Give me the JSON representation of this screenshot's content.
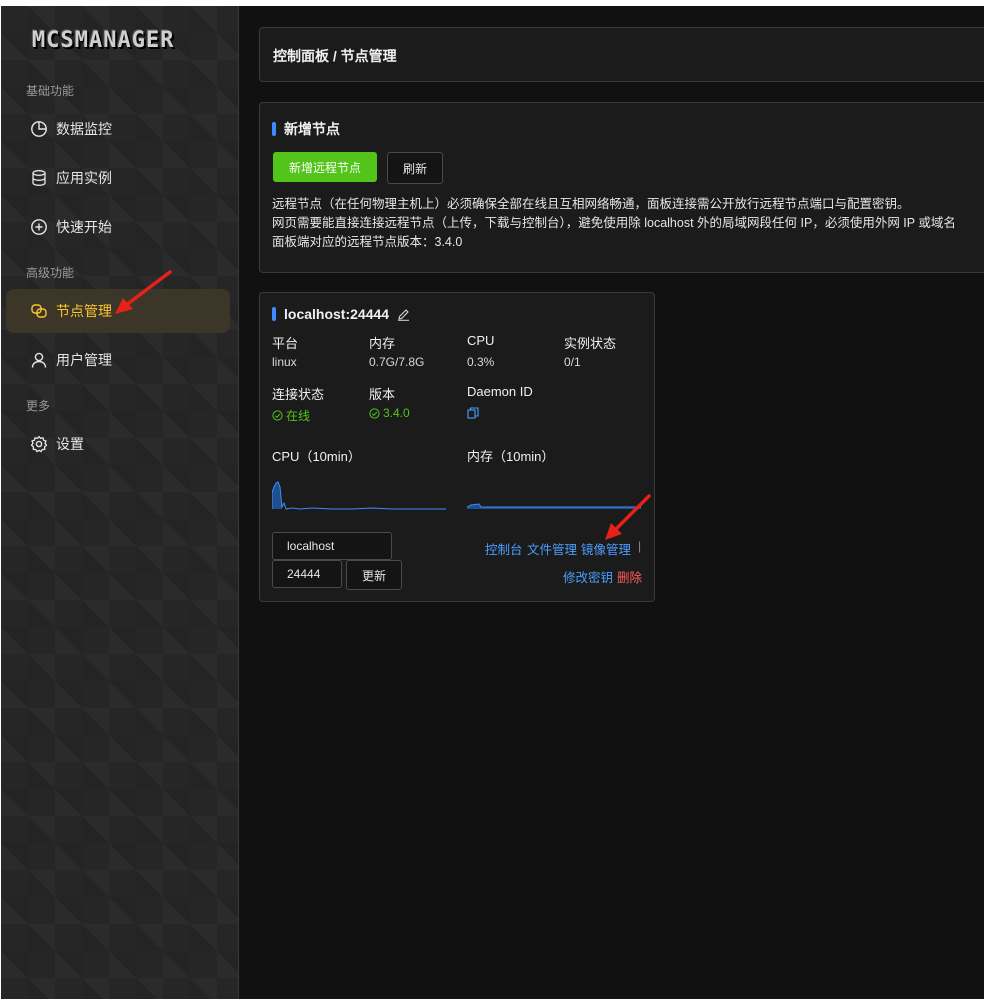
{
  "sidebar": {
    "logo": "MCSMANAGER",
    "sections": [
      "基础功能",
      "高级功能",
      "更多"
    ],
    "items": [
      {
        "label": "数据监控",
        "icon": "pie-chart-icon"
      },
      {
        "label": "应用实例",
        "icon": "database-icon"
      },
      {
        "label": "快速开始",
        "icon": "plus-circle-icon"
      },
      {
        "label": "节点管理",
        "icon": "nodes-icon",
        "active": true
      },
      {
        "label": "用户管理",
        "icon": "user-icon"
      },
      {
        "label": "设置",
        "icon": "gear-icon"
      }
    ]
  },
  "breadcrumb": "控制面板 / 节点管理",
  "add_node": {
    "title": "新增节点",
    "add_button": "新增远程节点",
    "refresh_button": "刷新",
    "desc1": "远程节点（在任何物理主机上）必须确保全部在线且互相网络畅通，面板连接需公开放行远程节点端口与配置密钥。",
    "desc2": "网页需要能直接连接远程节点（上传，下载与控制台），避免使用除 localhost 外的局域网段任何 IP，必须使用外网 IP 或域名",
    "desc3": "面板端对应的远程节点版本：3.4.0"
  },
  "node": {
    "title": "localhost:24444",
    "platform_label": "平台",
    "platform_value": "linux",
    "memory_label": "内存",
    "memory_value": "0.7G/7.8G",
    "cpu_label": "CPU",
    "cpu_value": "0.3%",
    "instance_label": "实例状态",
    "instance_value": "0/1",
    "conn_label": "连接状态",
    "conn_value": "在线",
    "version_label": "版本",
    "version_value": "3.4.0",
    "daemon_label": "Daemon ID",
    "cpu_chart_label": "CPU（10min）",
    "mem_chart_label": "内存（10min）",
    "host_value": "localhost",
    "port_value": "24444",
    "update_button": "更新",
    "link_console": "控制台",
    "link_files": "文件管理",
    "link_images": "镜像管理",
    "separator": "|",
    "link_change_key": "修改密钥",
    "link_delete": "删除"
  },
  "colors": {
    "accent_yellow": "#ffc431",
    "accent_blue": "#3c8cff",
    "green": "#52c41a",
    "red": "#ff5b5b",
    "annotation_arrow": "#e8201a"
  }
}
